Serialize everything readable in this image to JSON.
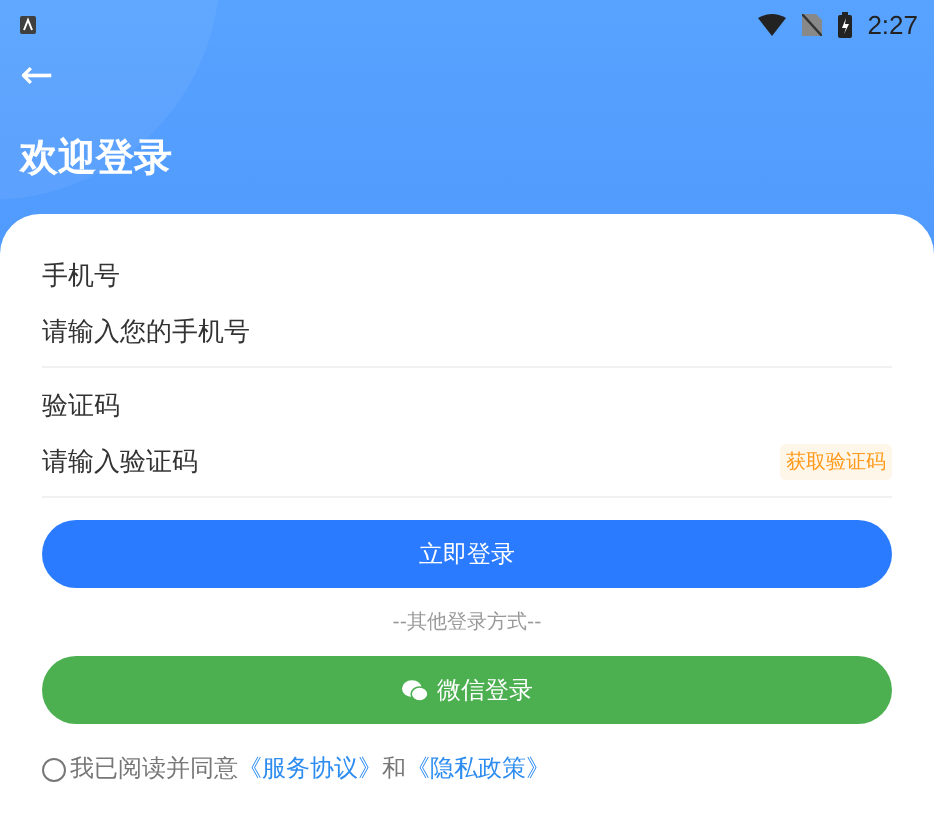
{
  "status_bar": {
    "time": "2:27"
  },
  "header": {
    "back_icon": "←",
    "title": "欢迎登录"
  },
  "fields": [
    {
      "label": "手机号",
      "placeholder": "请输入您的手机号"
    },
    {
      "label": "验证码",
      "placeholder": "请输入验证码",
      "action": "获取验证码"
    }
  ],
  "login_button": "立即登录",
  "divider_text": "--其他登录方式--",
  "wechat_button": "微信登录",
  "agreement": {
    "checked": false,
    "prefix": "我已阅读并同意",
    "terms": "《服务协议》",
    "middle": "和",
    "privacy": "《隐私政策》"
  }
}
